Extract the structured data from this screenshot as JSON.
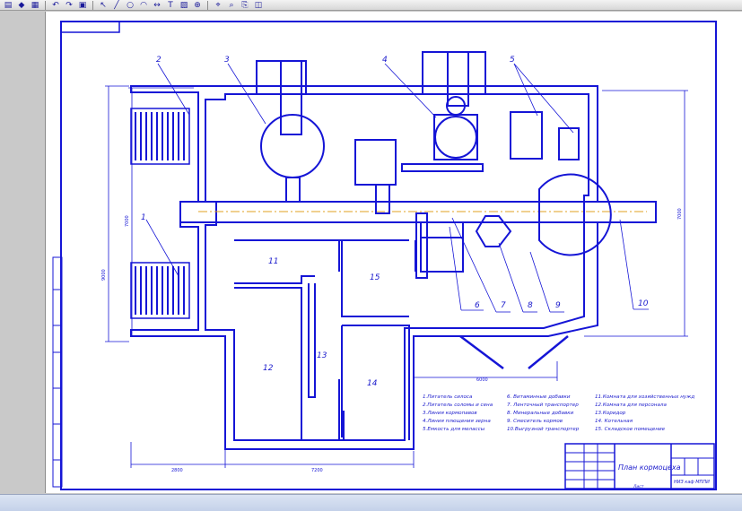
{
  "toolbar": {
    "icons": [
      "open-icon",
      "save-icon",
      "print-icon",
      "undo-icon",
      "redo-icon",
      "properties-icon",
      "select-icon",
      "line-icon",
      "circle-icon",
      "arc-icon",
      "dimension-icon",
      "text-icon",
      "hatch-icon",
      "measure-icon",
      "snap-icon",
      "zoom-icon",
      "copy-icon",
      "mirror-icon"
    ]
  },
  "colors": {
    "line": "#1515d6",
    "hatch_fill": "#1515d6",
    "axis": "#e0a020",
    "sheet": "#ffffff",
    "background": "#c9c9c9"
  },
  "drawing": {
    "callouts": [
      "1",
      "2",
      "3",
      "4",
      "5",
      "6",
      "7",
      "8",
      "9",
      "10"
    ],
    "room_numbers": [
      "11",
      "12",
      "13",
      "14",
      "15"
    ],
    "dimensions": {
      "height_left": "9000",
      "height_mid": "7000",
      "height_right": "7000",
      "width_bottom": "6000",
      "width_left": "2800",
      "width_mid": "7200"
    },
    "legend": [
      "1.Питатель силоса",
      "2.Питатель соломы и сена",
      "3.Линия кормопавов",
      "4.Линия плющения зерна",
      "5.Емкость для мелассы",
      "6. Витаминные добавки",
      "7. Ленточный транспортер",
      "8. Минеральные добавки",
      "9. Смеситель кормов",
      "10.Выгрузной транспортер",
      "11.Комната для хозяйственных нужд",
      "12.Комната для персонала",
      "13.Коридор",
      "14. Котельная",
      "15. Складское помещение"
    ]
  },
  "title_block": {
    "title": "План кормоцеха",
    "sheet": "Лист",
    "organization": "НИЗ каф МППИ"
  }
}
